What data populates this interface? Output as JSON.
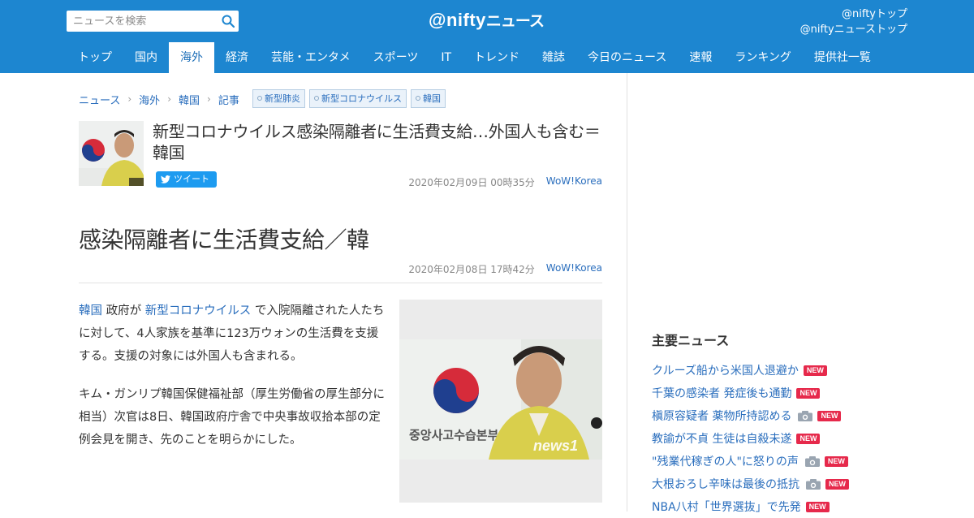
{
  "header": {
    "search_placeholder": "ニュースを検索",
    "logo_at": "@nifty",
    "logo_kana": "ニュース",
    "links": [
      "@niftyトップ",
      "@niftyニューストップ"
    ],
    "nav": [
      "トップ",
      "国内",
      "海外",
      "経済",
      "芸能・エンタメ",
      "スポーツ",
      "IT",
      "トレンド",
      "雑誌",
      "今日のニュース",
      "速報",
      "ランキング",
      "提供社一覧"
    ],
    "active_nav": "海外"
  },
  "breadcrumb": [
    "ニュース",
    "海外",
    "韓国",
    "記事"
  ],
  "tags": [
    "新型肺炎",
    "新型コロナウイルス",
    "韓国"
  ],
  "article": {
    "title": "新型コロナウイルス感染隔離者に生活費支給…外国人も含む＝韓国",
    "tweet_label": "ツイート",
    "date": "2020年02月09日 00時35分",
    "source": "WoW!Korea",
    "headline": "感染隔離者に生活費支給／韓",
    "headline_date": "2020年02月08日 17時42分",
    "headline_source": "WoW!Korea",
    "p1_link1": "韓国",
    "p1_text1": " 政府が ",
    "p1_link2": "新型コロナウイルス",
    "p1_text2": " で入院隔離された人たちに対して、4人家族を基準に123万ウォンの生活費を支援する。支援の対象には外国人も含まれる。",
    "p2": "キム・ガンリプ韓国保健福祉部（厚生労働省の厚生部分に相当）次官は8日、韓国政府庁舎で中央事故収拾本部の定例会見を開き、先のことを明らかにした。",
    "photo_watermark": "news1",
    "photo_sign": "중앙사고수습본부"
  },
  "sidebar": {
    "heading": "主要ニュース",
    "items": [
      {
        "text": "クルーズ船から米国人退避か",
        "camera": false,
        "new": "NEW"
      },
      {
        "text": "千葉の感染者 発症後も通勤",
        "camera": false,
        "new": "NEW"
      },
      {
        "text": "槇原容疑者 薬物所持認める",
        "camera": true,
        "new": "NEW"
      },
      {
        "text": "教諭が不貞 生徒は自殺未遂",
        "camera": false,
        "new": "NEW"
      },
      {
        "text": "\"残業代稼ぎの人\"に怒りの声",
        "camera": true,
        "new": "NEW"
      },
      {
        "text": "大根おろし辛味は最後の抵抗",
        "camera": true,
        "new": "NEW"
      },
      {
        "text": "NBA八村「世界選抜」で先発",
        "camera": false,
        "new": "NEW"
      }
    ]
  }
}
